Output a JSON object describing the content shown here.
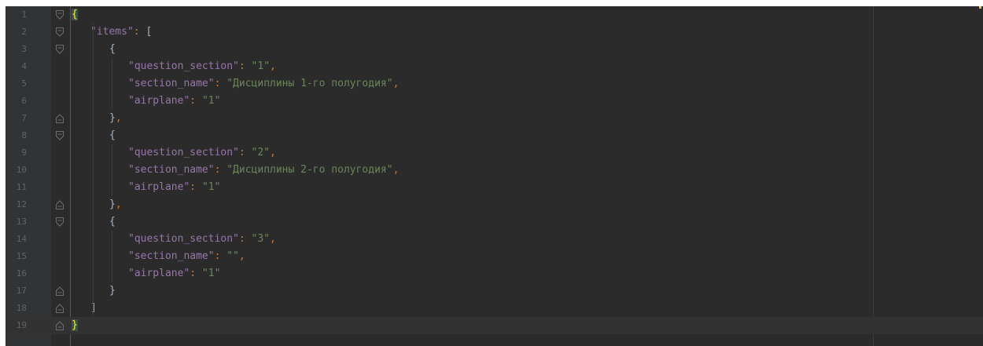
{
  "editor": {
    "lines": [
      {
        "n": "1",
        "indent": 0,
        "tokens": [
          {
            "t": "{",
            "c": "brace-hl"
          }
        ],
        "fold": "open"
      },
      {
        "n": "2",
        "indent": 1,
        "tokens": [
          {
            "t": "\"items\"",
            "c": "k"
          },
          {
            "t": ": ",
            "c": "c"
          },
          {
            "t": "[",
            "c": "p"
          }
        ],
        "fold": "open"
      },
      {
        "n": "3",
        "indent": 2,
        "tokens": [
          {
            "t": "{",
            "c": "p"
          }
        ],
        "fold": "open"
      },
      {
        "n": "4",
        "indent": 3,
        "tokens": [
          {
            "t": "\"question_section\"",
            "c": "k"
          },
          {
            "t": ": ",
            "c": "c"
          },
          {
            "t": "\"1\"",
            "c": "s"
          },
          {
            "t": ",",
            "c": "c"
          }
        ]
      },
      {
        "n": "5",
        "indent": 3,
        "tokens": [
          {
            "t": "\"section_name\"",
            "c": "k"
          },
          {
            "t": ": ",
            "c": "c"
          },
          {
            "t": "\"Дисциплины 1-го полугодия\"",
            "c": "s"
          },
          {
            "t": ",",
            "c": "c"
          }
        ]
      },
      {
        "n": "6",
        "indent": 3,
        "tokens": [
          {
            "t": "\"airplane\"",
            "c": "k"
          },
          {
            "t": ": ",
            "c": "c"
          },
          {
            "t": "\"1\"",
            "c": "s"
          }
        ]
      },
      {
        "n": "7",
        "indent": 2,
        "tokens": [
          {
            "t": "}",
            "c": "p"
          },
          {
            "t": ",",
            "c": "c"
          }
        ],
        "fold": "close"
      },
      {
        "n": "8",
        "indent": 2,
        "tokens": [
          {
            "t": "{",
            "c": "p"
          }
        ],
        "fold": "open"
      },
      {
        "n": "9",
        "indent": 3,
        "tokens": [
          {
            "t": "\"question_section\"",
            "c": "k"
          },
          {
            "t": ": ",
            "c": "c"
          },
          {
            "t": "\"2\"",
            "c": "s"
          },
          {
            "t": ",",
            "c": "c"
          }
        ]
      },
      {
        "n": "10",
        "indent": 3,
        "tokens": [
          {
            "t": "\"section_name\"",
            "c": "k"
          },
          {
            "t": ": ",
            "c": "c"
          },
          {
            "t": "\"Дисциплины 2-го полугодия\"",
            "c": "s"
          },
          {
            "t": ",",
            "c": "c"
          }
        ]
      },
      {
        "n": "11",
        "indent": 3,
        "tokens": [
          {
            "t": "\"airplane\"",
            "c": "k"
          },
          {
            "t": ": ",
            "c": "c"
          },
          {
            "t": "\"1\"",
            "c": "s"
          }
        ]
      },
      {
        "n": "12",
        "indent": 2,
        "tokens": [
          {
            "t": "}",
            "c": "p"
          },
          {
            "t": ",",
            "c": "c"
          }
        ],
        "fold": "close"
      },
      {
        "n": "13",
        "indent": 2,
        "tokens": [
          {
            "t": "{",
            "c": "p"
          }
        ],
        "fold": "open"
      },
      {
        "n": "14",
        "indent": 3,
        "tokens": [
          {
            "t": "\"question_section\"",
            "c": "k"
          },
          {
            "t": ": ",
            "c": "c"
          },
          {
            "t": "\"3\"",
            "c": "s"
          },
          {
            "t": ",",
            "c": "c"
          }
        ]
      },
      {
        "n": "15",
        "indent": 3,
        "tokens": [
          {
            "t": "\"section_name\"",
            "c": "k"
          },
          {
            "t": ": ",
            "c": "c"
          },
          {
            "t": "\"\"",
            "c": "s"
          },
          {
            "t": ",",
            "c": "c"
          }
        ]
      },
      {
        "n": "16",
        "indent": 3,
        "tokens": [
          {
            "t": "\"airplane\"",
            "c": "k"
          },
          {
            "t": ": ",
            "c": "c"
          },
          {
            "t": "\"1\"",
            "c": "s"
          }
        ]
      },
      {
        "n": "17",
        "indent": 2,
        "tokens": [
          {
            "t": "}",
            "c": "p"
          }
        ],
        "fold": "close"
      },
      {
        "n": "18",
        "indent": 1,
        "tokens": [
          {
            "t": "]",
            "c": "p"
          }
        ],
        "fold": "close"
      },
      {
        "n": "19",
        "indent": 0,
        "tokens": [
          {
            "t": "}",
            "c": "brace-hl"
          }
        ],
        "fold": "close",
        "current": true
      }
    ],
    "colors": {
      "background": "#2b2b2b",
      "gutter": "#313335",
      "key": "#9876aa",
      "string": "#6a8759",
      "punctuation": "#cc7832",
      "bracket_highlight": "#ffef28"
    }
  }
}
